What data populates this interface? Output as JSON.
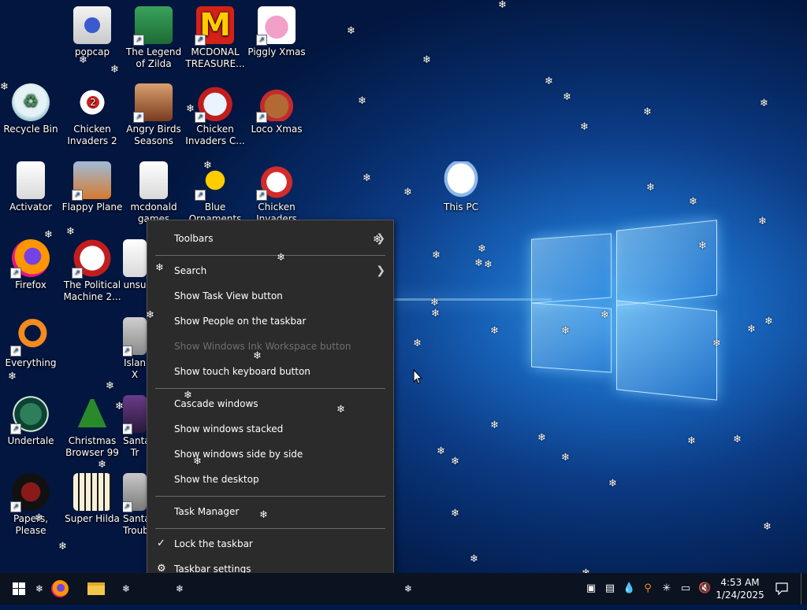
{
  "desktop_icons": [
    {
      "label": "popcap"
    },
    {
      "label": "The Legend of Zilda"
    },
    {
      "label": "MCDONAL TREASURE..."
    },
    {
      "label": "Piggly Xmas"
    },
    {
      "label": "Recycle Bin"
    },
    {
      "label": "Chicken Invaders 2"
    },
    {
      "label": "Angry Birds Seasons"
    },
    {
      "label": "Chicken Invaders C..."
    },
    {
      "label": "Loco Xmas"
    },
    {
      "label": "Activator"
    },
    {
      "label": "Flappy Plane"
    },
    {
      "label": "mcdonald games"
    },
    {
      "label": "Blue Ornaments"
    },
    {
      "label": "Chicken Invaders"
    },
    {
      "label": "This PC"
    },
    {
      "label": "Firefox"
    },
    {
      "label": "The Political Machine 2..."
    },
    {
      "label": "unsu"
    },
    {
      "label": "Everything"
    },
    {
      "label": "Islan X"
    },
    {
      "label": "Undertale"
    },
    {
      "label": "Christmas Browser 99"
    },
    {
      "label": "Santa Tr"
    },
    {
      "label": "Papers, Please"
    },
    {
      "label": "Super Hilda"
    },
    {
      "label": "Santa Troubl"
    }
  ],
  "context_menu": {
    "items": [
      {
        "label": "Toolbars",
        "submenu": true
      },
      {
        "label": "Search",
        "submenu": true
      },
      {
        "label": "Show Task View button"
      },
      {
        "label": "Show People on the taskbar"
      },
      {
        "label": "Show Windows Ink Workspace button",
        "disabled": true
      },
      {
        "label": "Show touch keyboard button"
      },
      {
        "label": "Cascade windows"
      },
      {
        "label": "Show windows stacked"
      },
      {
        "label": "Show windows side by side"
      },
      {
        "label": "Show the desktop"
      },
      {
        "label": "Task Manager"
      },
      {
        "label": "Lock the taskbar",
        "checked": true
      },
      {
        "label": "Taskbar settings",
        "icon": "gear-icon"
      }
    ]
  },
  "taskbar": {
    "clock_time": "4:53 AM",
    "clock_date": "1/24/2025",
    "pinned": [
      "start-icon",
      "snowflake-icon",
      "firefox-icon",
      "file-explorer-icon"
    ],
    "tray_icons": [
      "security-icon",
      "program-icon",
      "water-drop-icon",
      "search-everything-icon",
      "snowflake-tray-icon",
      "network-icon",
      "volume-muted-icon"
    ]
  },
  "colors": {
    "menu_bg": "#2b2b2b",
    "taskbar_bg": "#0b1220",
    "accent": "#1f7fe0"
  }
}
